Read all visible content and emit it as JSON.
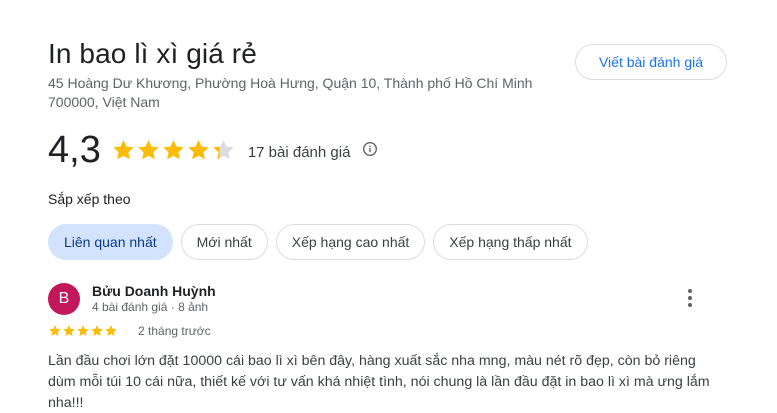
{
  "business": {
    "name": "In bao lì xì giá rẻ",
    "address": "45 Hoàng Dư Khương, Phường Hoà Hưng, Quận 10, Thành phố Hồ Chí Minh 700000, Việt Nam",
    "write_review_label": "Viết bài đánh giá"
  },
  "rating": {
    "value": "4,3",
    "numeric": 4.3,
    "count_label": "17 bài đánh giá",
    "star_color": "#fbbc04",
    "empty_star_color": "#dadce0"
  },
  "sort": {
    "label": "Sắp xếp theo",
    "options": [
      {
        "label": "Liên quan nhất",
        "active": true
      },
      {
        "label": "Mới nhất",
        "active": false
      },
      {
        "label": "Xếp hạng cao nhất",
        "active": false
      },
      {
        "label": "Xếp hạng thấp nhất",
        "active": false
      }
    ]
  },
  "review": {
    "avatar_letter": "B",
    "avatar_color": "#c2185b",
    "author": "Bửu Doanh Huỳnh",
    "meta": "4 bài đánh giá · 8 ảnh",
    "stars": 5,
    "date": "2 tháng trước",
    "text": "Lần đầu chơi lớn đặt 10000 cái bao lì xì bên đây, hàng xuất sắc nha mng, màu nét rõ đẹp, còn bỏ riêng dùm mỗi túi 10 cái nữa, thiết kế với tư vấn khá nhiệt tình, nói chung là lần đầu đặt in bao lì xì mà ưng lắm nha!!!"
  }
}
